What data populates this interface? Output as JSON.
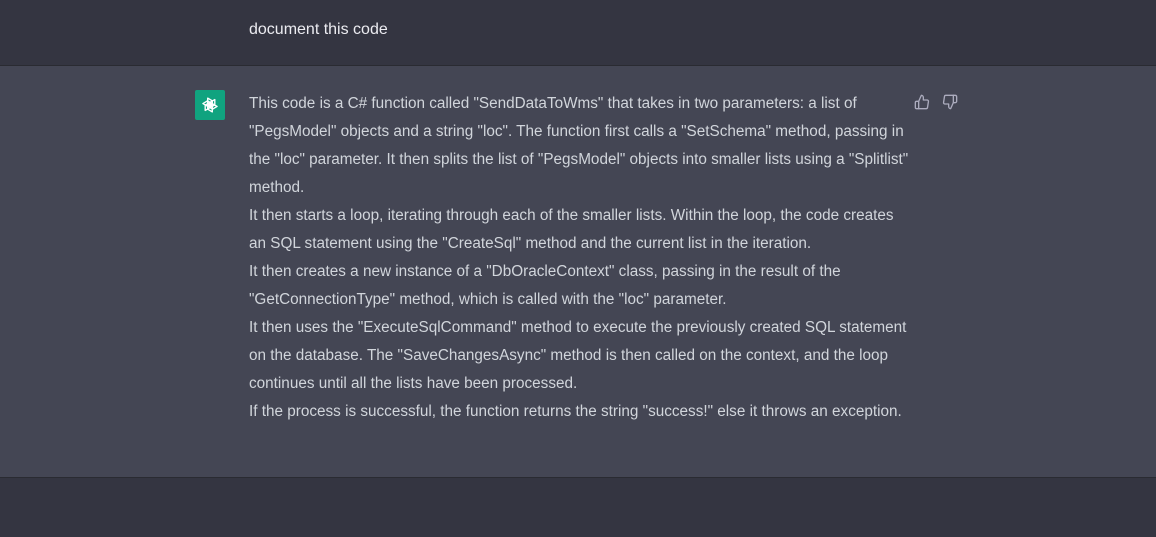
{
  "user_message": {
    "text": "document this code"
  },
  "assistant_message": {
    "paragraphs": [
      "This code is a C# function called \"SendDataToWms\" that takes in two parameters: a list of \"PegsModel\" objects and a string \"loc\". The function first calls a \"SetSchema\" method, passing in the \"loc\" parameter. It then splits the list of \"PegsModel\" objects into smaller lists using a \"Splitlist\" method.",
      "It then starts a loop, iterating through each of the smaller lists. Within the loop, the code creates an SQL statement using the \"CreateSql\" method and the current list in the iteration.",
      "It then creates a new instance of a \"DbOracleContext\" class, passing in the result of the \"GetConnectionType\" method, which is called with the \"loc\" parameter.",
      "It then uses the \"ExecuteSqlCommand\" method to execute the previously created SQL statement on the database. The \"SaveChangesAsync\" method is then called on the context, and the loop continues until all the lists have been processed.",
      "If the process is successful, the function returns the string \"success!\" else it throws an exception."
    ],
    "avatar_icon": "openai-logo-icon",
    "feedback": {
      "up_icon": "thumbs-up-icon",
      "down_icon": "thumbs-down-icon"
    }
  },
  "colors": {
    "user_bg": "#343541",
    "assistant_bg": "#444654",
    "avatar_bg": "#10a37f",
    "text": "#d1d5db"
  }
}
